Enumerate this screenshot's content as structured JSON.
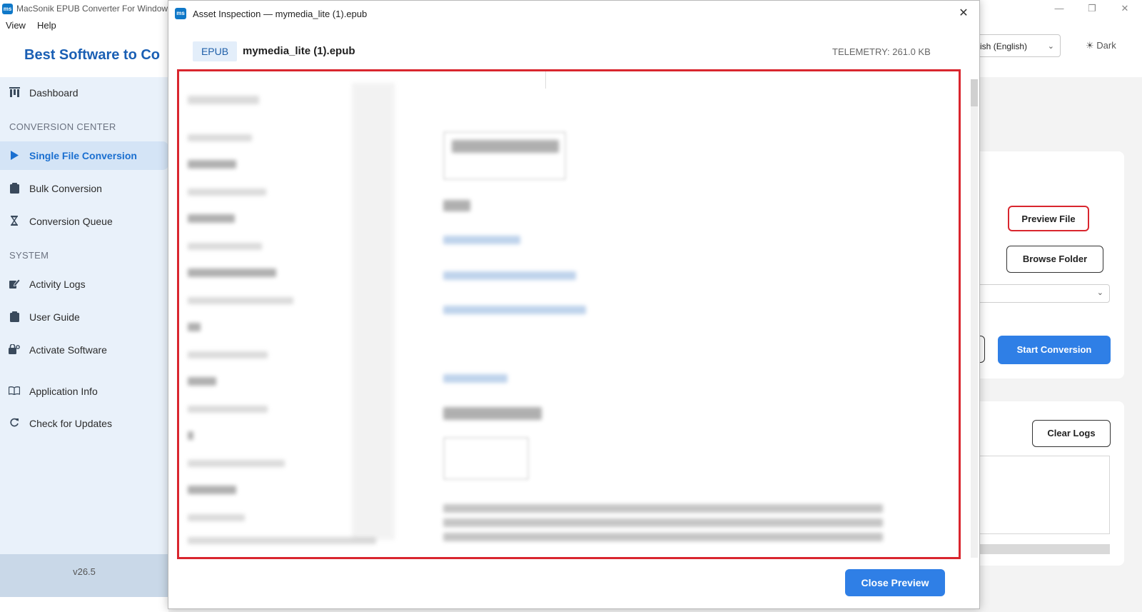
{
  "app": {
    "title": "MacSonik EPUB Converter For Windows",
    "icon_text": "ms",
    "menu": [
      "View",
      "Help"
    ],
    "window_controls": [
      "—",
      "❐",
      "✕"
    ]
  },
  "sidebar": {
    "brand": "Best Software to Co",
    "items": [
      {
        "label": "Dashboard",
        "icon": "dashboard-icon"
      },
      {
        "label": "Single File Conversion",
        "icon": "play-icon",
        "active": true
      },
      {
        "label": "Bulk Conversion",
        "icon": "clipboard-icon"
      },
      {
        "label": "Conversion Queue",
        "icon": "hourglass-icon"
      },
      {
        "label": "Activity Logs",
        "icon": "edit-log-icon"
      },
      {
        "label": "User Guide",
        "icon": "guide-icon"
      },
      {
        "label": "Activate Software",
        "icon": "key-lock-icon"
      },
      {
        "label": "Application Info",
        "icon": "book-icon"
      },
      {
        "label": "Check for Updates",
        "icon": "refresh-icon"
      }
    ],
    "sections": [
      "CONVERSION CENTER",
      "SYSTEM"
    ],
    "version": "v26.5"
  },
  "header": {
    "language": "English (English)",
    "theme_toggle": "☀ Dark"
  },
  "main": {
    "preview_file": "Preview File",
    "browse_folder": "Browse Folder",
    "start_conversion": "Start Conversion",
    "clear_logs": "Clear Logs"
  },
  "modal": {
    "title": "Asset Inspection — mymedia_lite (1).epub",
    "icon_text": "ms",
    "format_badge": "EPUB",
    "file_name": "mymedia_lite (1).epub",
    "telemetry": "TELEMETRY: 261.0 KB",
    "close_preview": "Close Preview"
  },
  "colors": {
    "accent": "#2f7fe6",
    "brand": "#1a5fb4",
    "highlight": "#d9262e"
  }
}
